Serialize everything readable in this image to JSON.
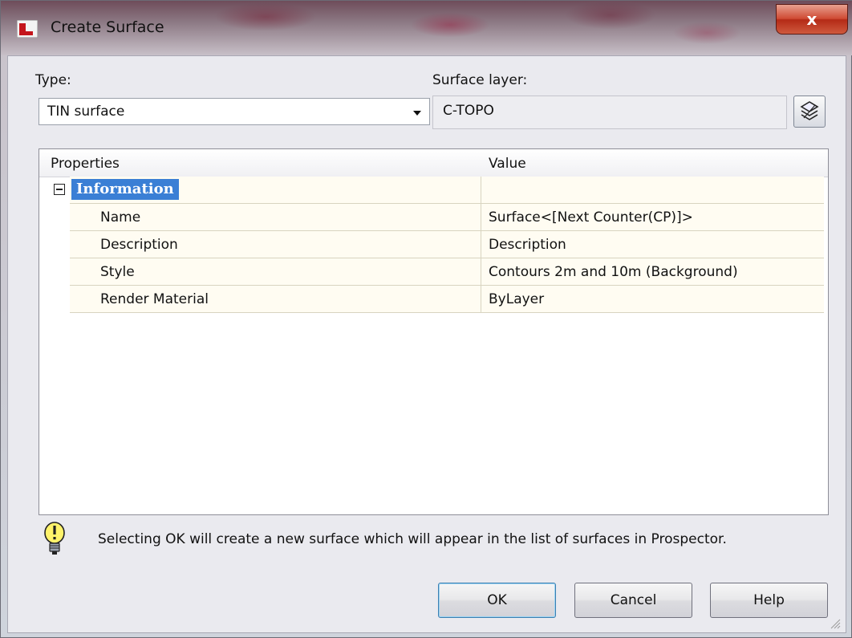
{
  "window": {
    "title": "Create Surface",
    "close_glyph": "x",
    "titlebar_colors": [
      "#6e4c5a",
      "#c8c0c8"
    ],
    "close_color": "#cf4a33"
  },
  "type_field": {
    "label": "Type:",
    "value": "TIN surface"
  },
  "surface_layer": {
    "label": "Surface layer:",
    "value": "C-TOPO",
    "button_icon": "layers-icon"
  },
  "properties": {
    "columns": [
      "Properties",
      "Value"
    ],
    "category": "Information",
    "rows": [
      {
        "property": "Name",
        "value": "Surface<[Next Counter(CP)]>"
      },
      {
        "property": "Description",
        "value": "Description"
      },
      {
        "property": "Style",
        "value": "Contours 2m and 10m (Background)"
      },
      {
        "property": "Render Material",
        "value": "ByLayer"
      }
    ],
    "selection_color": "#3a7fd5"
  },
  "info": {
    "icon": "lightbulb-icon",
    "message": "Selecting OK will create a new surface which will appear in the list of surfaces in Prospector."
  },
  "buttons": {
    "ok": "OK",
    "cancel": "Cancel",
    "help": "Help"
  }
}
